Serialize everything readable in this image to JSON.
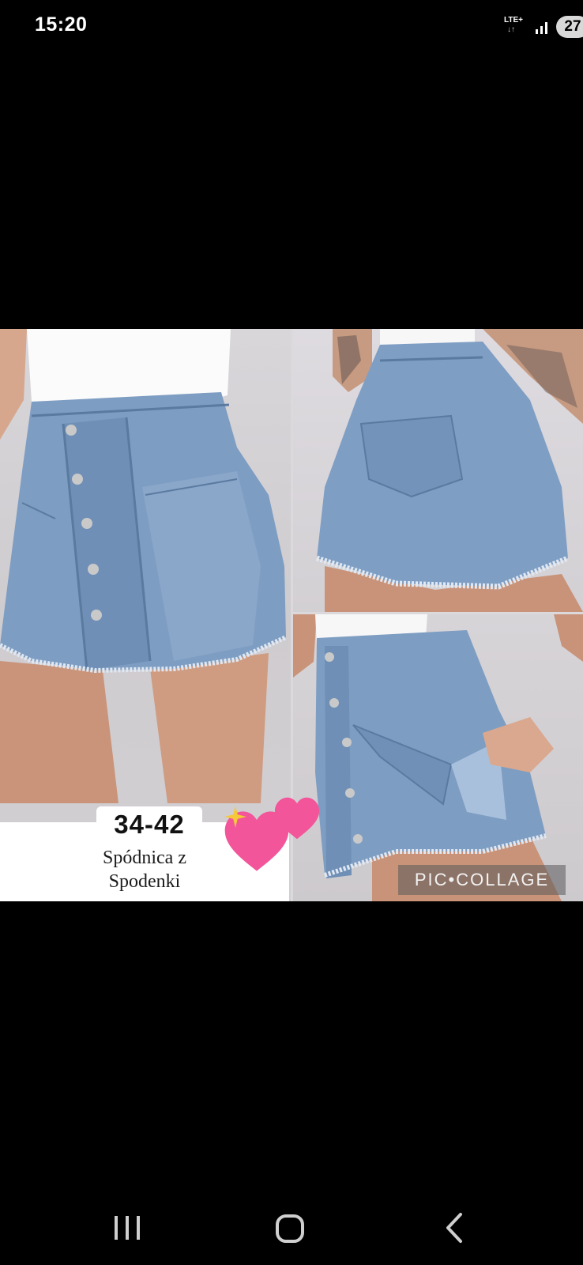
{
  "status_bar": {
    "time": "15:20",
    "network": "LTE+",
    "network_arrows": "↓↑",
    "battery": "27"
  },
  "collage": {
    "size_range": "34-42",
    "caption_line1": "Spódnica z",
    "caption_line2": "Spodenki",
    "watermark": "PIC•COLLAGE",
    "heart_color": "#f2559a"
  },
  "nav_bar": {
    "recents_icon": "recents-icon",
    "home_icon": "home-icon",
    "back_icon": "back-icon"
  }
}
